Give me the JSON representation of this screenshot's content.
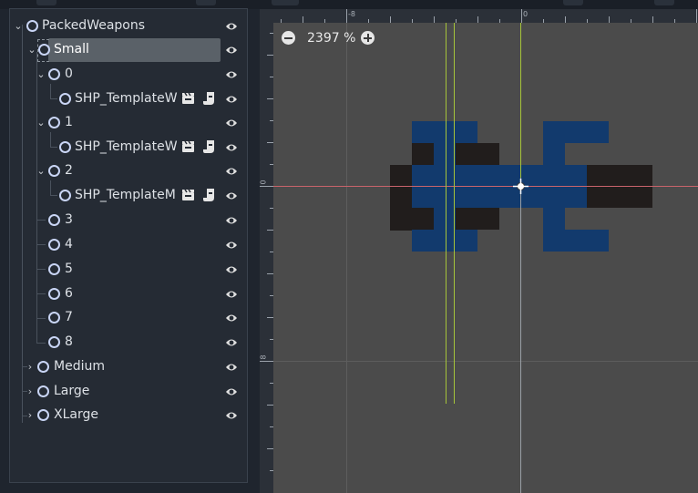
{
  "scene_tree": {
    "nodes": [
      {
        "label": "PackedWeapons"
      },
      {
        "label": "Small"
      },
      {
        "label": "0"
      },
      {
        "label": "SHP_TemplateW"
      },
      {
        "label": "1"
      },
      {
        "label": "SHP_TemplateW"
      },
      {
        "label": "2"
      },
      {
        "label": "SHP_TemplateM"
      },
      {
        "label": "3"
      },
      {
        "label": "4"
      },
      {
        "label": "5"
      },
      {
        "label": "6"
      },
      {
        "label": "7"
      },
      {
        "label": "8"
      },
      {
        "label": "Medium"
      },
      {
        "label": "Large"
      },
      {
        "label": "XLarge"
      }
    ]
  },
  "viewport": {
    "zoom_label": "2397 %",
    "ruler_top_labels": [
      "-8",
      "0"
    ],
    "ruler_left_labels": [
      "0",
      "8"
    ]
  },
  "colors": {
    "ship_blue": "#123a6d",
    "ship_dark": "#211d1c",
    "axis_red": "#c8636b",
    "guide_green": "#a6c43a"
  }
}
